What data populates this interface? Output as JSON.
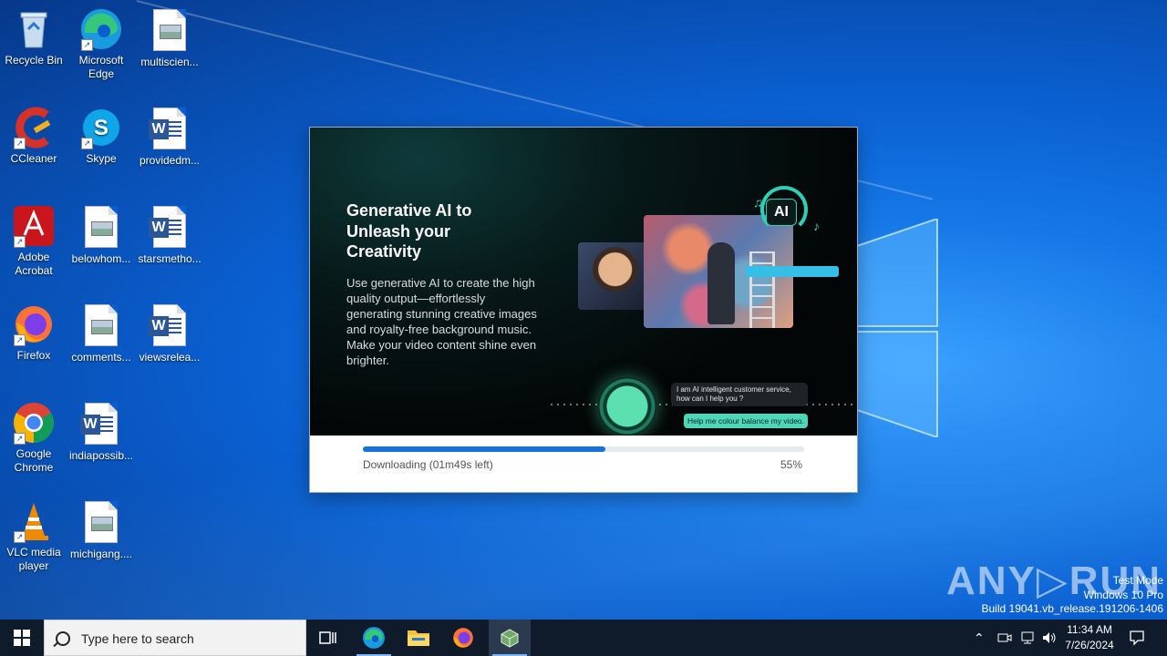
{
  "desktop": {
    "icons": [
      {
        "label": "Recycle Bin"
      },
      {
        "label": "Microsoft Edge"
      },
      {
        "label": "multiscien..."
      },
      {
        "label": "CCleaner"
      },
      {
        "label": "Skype"
      },
      {
        "label": "providedm..."
      },
      {
        "label": "Adobe Acrobat"
      },
      {
        "label": "belowhom..."
      },
      {
        "label": "starsmetho..."
      },
      {
        "label": "Firefox"
      },
      {
        "label": "comments..."
      },
      {
        "label": "viewsrelea..."
      },
      {
        "label": "Google Chrome"
      },
      {
        "label": "indiapossib..."
      },
      {
        "label": "VLC media player"
      },
      {
        "label": "michigang...."
      }
    ]
  },
  "installer": {
    "title": "Generative AI to Unleash your Creativity",
    "body": "Use generative AI to create the high quality output—effortlessly generating stunning creative images and royalty-free background music. Make your video content shine even brighter.",
    "collage": {
      "ai_badge": "AI",
      "chat_question": "I am AI intelligent customer service, how can I help you ?",
      "chat_reply": "Help me colour balance my video."
    },
    "progress": {
      "status": "Downloading (01m49s left)",
      "percent_label": "55%",
      "value": 0.55
    }
  },
  "watermark": {
    "brand": "ANY RUN",
    "line1": "Test Mode",
    "line2": "Windows 10 Pro",
    "line3": "Build 19041.vb_release.191206-1406"
  },
  "taskbar": {
    "search_placeholder": "Type here to search",
    "time": "11:34 AM",
    "date": "7/26/2024"
  },
  "colors": {
    "accent": "#1a72d8",
    "taskbar": "#0f1a2b",
    "chat_reply_bg": "#4fd6b8"
  }
}
